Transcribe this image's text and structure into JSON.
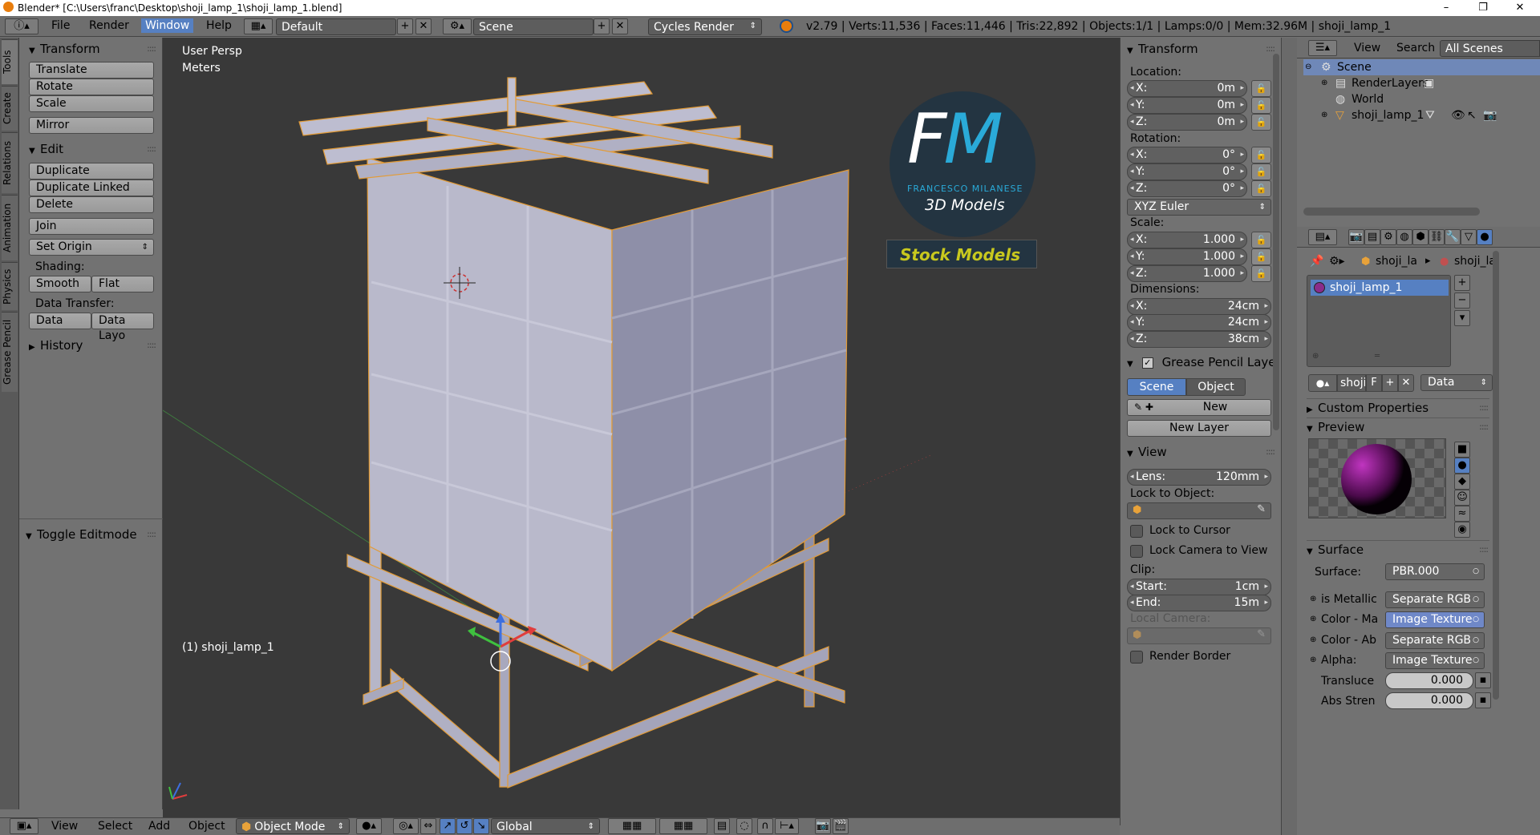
{
  "window": {
    "title": "Blender* [C:\\Users\\franc\\Desktop\\shoji_lamp_1\\shoji_lamp_1.blend]",
    "minimize": "–",
    "maximize": "❐",
    "close": "✕"
  },
  "topbar": {
    "menus": [
      "File",
      "Render",
      "Window",
      "Help"
    ],
    "layout_name": "Default",
    "scene_name": "Scene",
    "render_engine": "Cycles Render",
    "status": "v2.79 | Verts:11,536 | Faces:11,446 | Tris:22,892 | Objects:1/1 | Lamps:0/0 | Mem:32.96M | shoji_lamp_1"
  },
  "left_tabs": [
    "Tools",
    "Create",
    "Relations",
    "Animation",
    "Physics",
    "Grease Pencil"
  ],
  "tools": {
    "transform_title": "Transform",
    "translate": "Translate",
    "rotate": "Rotate",
    "scale": "Scale",
    "mirror": "Mirror",
    "edit_title": "Edit",
    "duplicate": "Duplicate",
    "duplicate_linked": "Duplicate Linked",
    "delete": "Delete",
    "join": "Join",
    "set_origin": "Set Origin",
    "shading_label": "Shading:",
    "smooth": "Smooth",
    "flat": "Flat",
    "data_transfer_label": "Data Transfer:",
    "data": "Data",
    "data_layo": "Data Layo",
    "history_title": "History",
    "toggle_editmode": "Toggle Editmode"
  },
  "viewport": {
    "view_name": "User Persp",
    "units": "Meters",
    "object_label": "(1) shoji_lamp_1",
    "watermark_big": "FM",
    "watermark_name": "FRANCESCO MILANESE",
    "watermark_sub": "3D Models",
    "watermark_banner": "Stock Models",
    "watermark_bg": "#233441",
    "watermark_f": "#ffffff",
    "watermark_m": "#2aaad8",
    "banner_text_color": "#c8c81e"
  },
  "bottombar": {
    "view": "View",
    "select": "Select",
    "add": "Add",
    "object": "Object",
    "mode": "Object Mode",
    "orientation": "Global"
  },
  "npanel": {
    "transform_title": "Transform",
    "location_label": "Location:",
    "loc_x": "0m",
    "loc_y": "0m",
    "loc_z": "0m",
    "rotation_label": "Rotation:",
    "rot_x": "0°",
    "rot_y": "0°",
    "rot_z": "0°",
    "rotation_mode": "XYZ Euler",
    "scale_label": "Scale:",
    "scale_x": "1.000",
    "scale_y": "1.000",
    "scale_z": "1.000",
    "dimensions_label": "Dimensions:",
    "dim_x": "24cm",
    "dim_y": "24cm",
    "dim_z": "38cm",
    "axis_x": "X:",
    "axis_y": "Y:",
    "axis_z": "Z:",
    "grease_title": "Grease Pencil Layer",
    "gp_scene": "Scene",
    "gp_object": "Object",
    "gp_new": "New",
    "gp_new_layer": "New Layer",
    "view_title": "View",
    "lens_label": "Lens:",
    "lens_value": "120mm",
    "lock_to_object": "Lock to Object:",
    "lock_to_cursor": "Lock to Cursor",
    "lock_camera": "Lock Camera to View",
    "clip_label": "Clip:",
    "clip_start_label": "Start:",
    "clip_start": "1cm",
    "clip_end_label": "End:",
    "clip_end": "15m",
    "local_camera": "Local Camera:",
    "render_border": "Render Border"
  },
  "outliner": {
    "view": "View",
    "search": "Search",
    "filter": "All Scenes",
    "items": [
      "Scene",
      "RenderLayers",
      "World",
      "shoji_lamp_1"
    ]
  },
  "properties": {
    "breadcrumb_1": "shoji_la",
    "breadcrumb_2": "shoji_la",
    "material_slot": "shoji_lamp_1",
    "material_name": "shoji_",
    "material_f": "F",
    "data_select": "Data",
    "custom_props": "Custom Properties",
    "preview": "Preview",
    "surface_title": "Surface",
    "surface_label": "Surface:",
    "surface_value": "PBR.000",
    "inputs": [
      {
        "label": "is Metallic",
        "value": "Separate RGB"
      },
      {
        "label": "Color - Ma",
        "value": "Image Texture"
      },
      {
        "label": "Color - Ab",
        "value": "Separate RGB"
      },
      {
        "label": "Alpha:",
        "value": "Image Texture"
      }
    ],
    "translucency_label": "Transluce",
    "translucency_value": "0.000",
    "abs_strength_label": "Abs Stren",
    "abs_strength_value": "0.000"
  }
}
